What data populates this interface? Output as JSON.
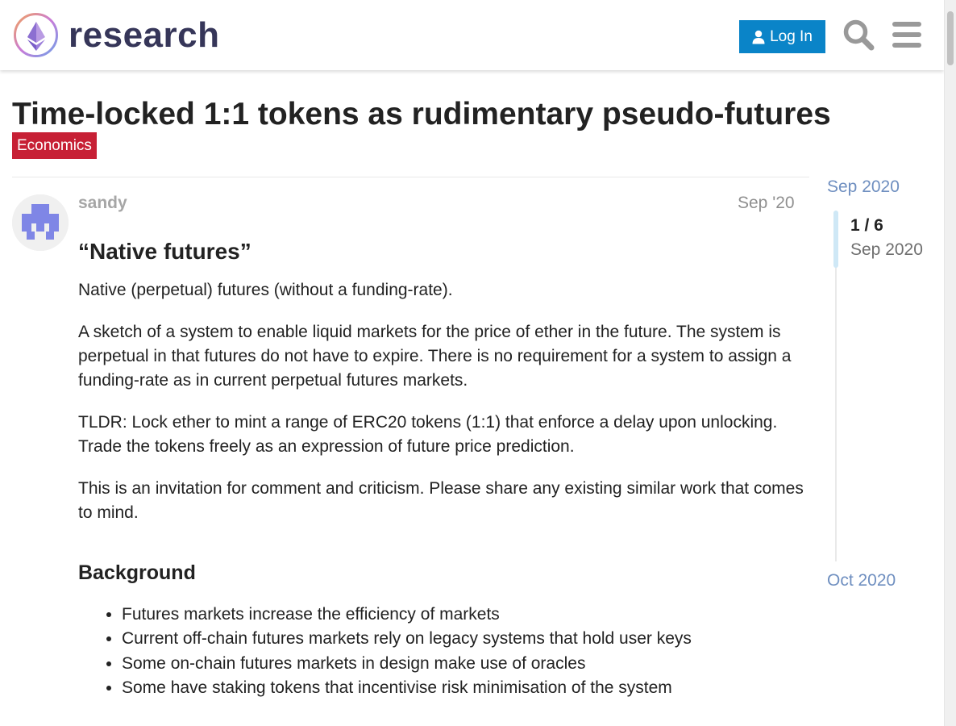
{
  "header": {
    "logo_text": "research",
    "login_label": "Log In"
  },
  "topic": {
    "title": "Time-locked 1:1 tokens as rudimentary pseudo-futures",
    "category": "Economics",
    "category_color": "#c72035"
  },
  "post": {
    "username": "sandy",
    "date": "Sep '20",
    "heading": "“Native futures”",
    "paragraphs": [
      "Native (perpetual) futures (without a funding-rate).",
      "A sketch of a system to enable liquid markets for the price of ether in the future. The system is perpetual in that futures do not have to expire. There is no requirement for a system to assign a funding-rate as in current perpetual futures markets.",
      "TLDR: Lock ether to mint a range of ERC20 tokens (1:1) that enforce a delay upon unlocking. Trade the tokens freely as an expression of future price prediction.",
      "This is an invitation for comment and criticism. Please share any existing similar work that comes to mind."
    ],
    "section_heading": "Background",
    "bullets": [
      "Futures markets increase the efficiency of markets",
      "Current off-chain futures markets rely on legacy systems that hold user keys",
      "Some on-chain futures markets in design make use of oracles",
      "Some have staking tokens that incentivise risk minimisation of the system"
    ]
  },
  "timeline": {
    "start": "Sep 2020",
    "count": "1 / 6",
    "current": "Sep 2020",
    "end": "Oct 2020"
  },
  "colors": {
    "accent": "#0a84c8",
    "category": "#c72035",
    "logo_text": "#363659",
    "timeline_date": "#6f8fc0",
    "avatar": "#7f86e6"
  },
  "icons": {
    "login": "user-icon",
    "search": "search-icon",
    "menu": "hamburger-icon"
  }
}
